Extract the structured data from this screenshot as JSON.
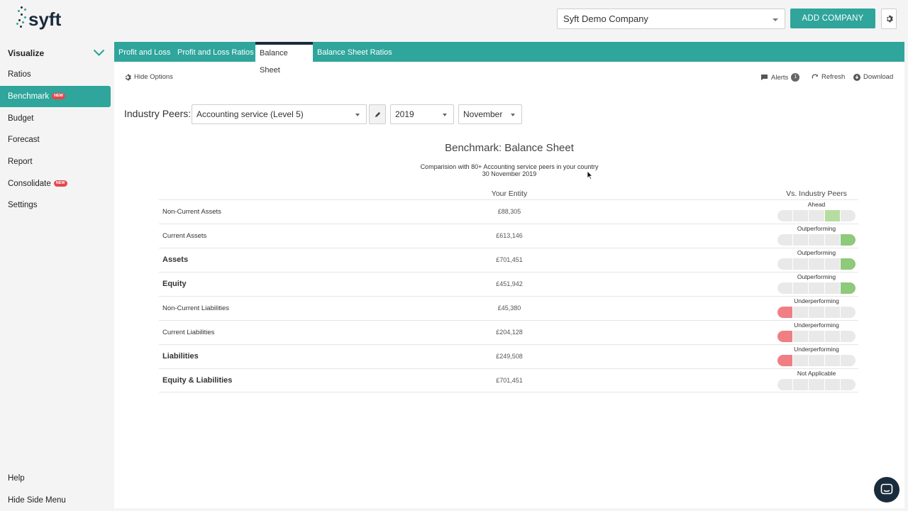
{
  "header": {
    "logo_text": "syft",
    "company": "Syft Demo Company",
    "add_company_label": "ADD COMPANY"
  },
  "sidebar": {
    "items": [
      {
        "label": "Visualize",
        "bold": true
      },
      {
        "label": "Ratios"
      },
      {
        "label": "Benchmark",
        "badge": "NEW",
        "active": true
      },
      {
        "label": "Budget"
      },
      {
        "label": "Forecast"
      },
      {
        "label": "Report"
      },
      {
        "label": "Consolidate",
        "badge": "NEW"
      },
      {
        "label": "Settings"
      }
    ],
    "footer": [
      "Help",
      "Hide Side Menu"
    ]
  },
  "tabs": [
    "Profit and Loss",
    "Profit and Loss Ratios",
    "Balance Sheet",
    "Balance Sheet Ratios"
  ],
  "active_tab": "Balance Sheet",
  "options": {
    "hide_options": "Hide Options",
    "alerts": "Alerts",
    "alerts_count": "1",
    "refresh": "Refresh",
    "download": "Download"
  },
  "filters": {
    "peers_label": "Industry Peers:",
    "industry": "Accounting service (Level 5)",
    "year": "2019",
    "month": "November"
  },
  "report": {
    "title": "Benchmark: Balance Sheet",
    "subtitle": "Comparision with 80+ Accounting service peers in your country",
    "date": "30 November 2019",
    "col_entity": "Your Entity",
    "col_peers": "Vs. Industry Peers"
  },
  "rows": [
    {
      "label": "Non-Current Assets",
      "bold": false,
      "value": "£88,305",
      "status": "Ahead",
      "level": 4,
      "tone": "light-green"
    },
    {
      "label": "Current Assets",
      "bold": false,
      "value": "£613,146",
      "status": "Outperforming",
      "level": 5,
      "tone": "green"
    },
    {
      "label": "Assets",
      "bold": true,
      "value": "£701,451",
      "status": "Outperforming",
      "level": 5,
      "tone": "green"
    },
    {
      "label": "Equity",
      "bold": true,
      "value": "£451,942",
      "status": "Outperforming",
      "level": 5,
      "tone": "green"
    },
    {
      "label": "Non-Current Liabilities",
      "bold": false,
      "value": "£45,380",
      "status": "Underperforming",
      "level": 1,
      "tone": "red"
    },
    {
      "label": "Current Liabilities",
      "bold": false,
      "value": "£204,128",
      "status": "Underperforming",
      "level": 1,
      "tone": "red"
    },
    {
      "label": "Liabilities",
      "bold": true,
      "value": "£249,508",
      "status": "Underperforming",
      "level": 1,
      "tone": "red"
    },
    {
      "label": "Equity & Liabilities",
      "bold": true,
      "value": "£701,451",
      "status": "Not Applicable",
      "level": 0,
      "tone": "none"
    }
  ],
  "colors": {
    "accent": "#2fa59c",
    "dark": "#1a2b3c",
    "green": "#8fc97a",
    "light_green": "#b5dd9f",
    "red": "#ef7f83",
    "neutral": "#e9e9e9"
  }
}
